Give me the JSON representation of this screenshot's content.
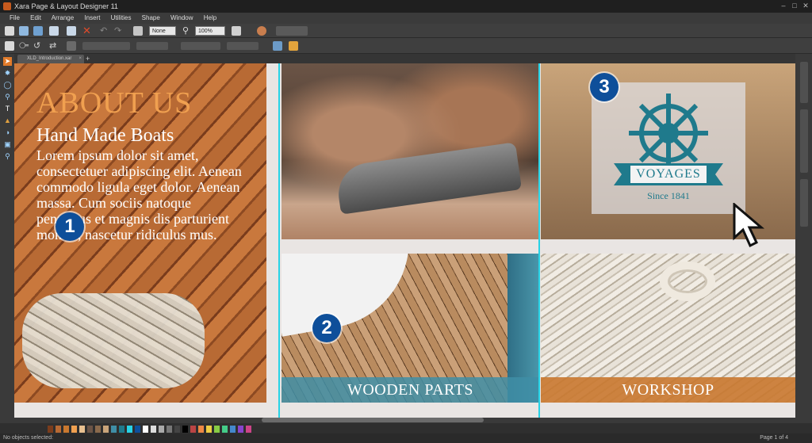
{
  "window": {
    "title": "Xara Page & Layout Designer 11"
  },
  "menu": [
    "File",
    "Edit",
    "Arrange",
    "Insert",
    "Utilities",
    "Shape",
    "Window",
    "Help"
  ],
  "toolbar": {
    "zoom_select": "None",
    "zoom_percent": "100%"
  },
  "document_tab": {
    "label": "XLD_Introduction.xar",
    "add_label": "+"
  },
  "left_tools": [
    "selector-tool",
    "contour-tool",
    "shape-tool",
    "zoom-tool",
    "text-tool",
    "fill-tool",
    "transparency-tool",
    "shadow-tool",
    "magnifier-tool"
  ],
  "right_galleries": [
    "Designs gallery",
    "Page & Layers gallery",
    "Bitmap gallery"
  ],
  "canvas": {
    "about": {
      "heading": "ABOUT US",
      "subheading": "Hand Made Boats",
      "body": "Lorem ipsum dolor sit amet, consectetuer adipiscing elit. Aenean commodo ligula eget dolor. Aenean massa. Cum sociis natoque penatibus et magnis dis parturient montes, nascetur ridiculus mus."
    },
    "wooden_parts_label": "WOODEN PARTS",
    "workshop_label": "WORKSHOP",
    "logo": {
      "title": "VOYAGES",
      "subtitle": "Since 1841"
    },
    "callouts": [
      "1",
      "2",
      "3"
    ]
  },
  "colors": {
    "accent_orange": "#f0a050",
    "guide_cyan": "#27d3e6",
    "callout_blue": "#0e4f9a",
    "logo_teal": "#1f7a8c",
    "wooden_parts_bar": "#3f8ea6",
    "workshop_bar": "#c9782f"
  },
  "status": {
    "message": "No objects selected:",
    "page": "Page 1 of 4"
  }
}
